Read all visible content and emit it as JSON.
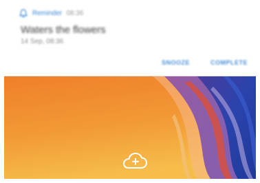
{
  "notification": {
    "app_name": "Reminder",
    "time": "08:36",
    "title": "Waters the flowers",
    "subtitle": "14 Sep, 08:36",
    "actions": {
      "snooze": "SNOOZE",
      "complete": "COMPLETE"
    },
    "icon": "bell-icon"
  },
  "wallpaper": {
    "colors": {
      "orange_top": "#f08a2c",
      "orange_bottom": "#f5b545",
      "blue_deep": "#233fa4",
      "purple": "#6b4fa8",
      "accent_red": "#d9473a"
    }
  },
  "cloud_button": {
    "icon": "cloud-add-icon"
  }
}
